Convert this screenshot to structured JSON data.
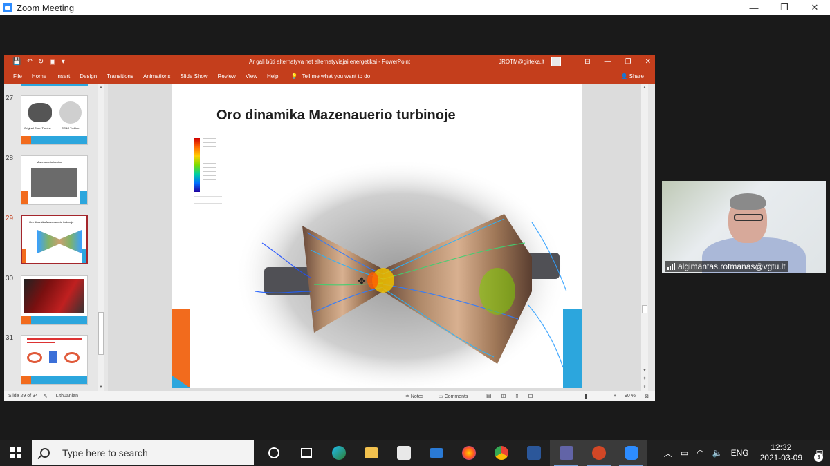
{
  "zoom": {
    "title": "Zoom Meeting",
    "minimize": "—",
    "maximize": "❐",
    "close": "✕"
  },
  "ppt": {
    "doc_title": "Ar gali būti alternatyva net alternatyviajai energetikai  -  PowerPoint",
    "user": "JROTM@girteka.lt",
    "tabs": [
      "File",
      "Home",
      "Insert",
      "Design",
      "Transitions",
      "Animations",
      "Slide Show",
      "Review",
      "View",
      "Help"
    ],
    "tell_me": "Tell me what you want to do",
    "share": "Share",
    "thumbnails": [
      {
        "num": "27",
        "caption_left": "Original Chen Turbine",
        "caption_right": "CEBC Turbine"
      },
      {
        "num": "28",
        "caption": "Mazenauerio turbina"
      },
      {
        "num": "29",
        "caption": "Oro dinamika Mazenauerio turbinoje"
      },
      {
        "num": "30"
      },
      {
        "num": "31"
      }
    ],
    "slide": {
      "title": "Oro dinamika Mazenauerio turbinoje"
    },
    "status": {
      "slide_count": "Slide 29 of 34",
      "language": "Lithuanian",
      "notes": "Notes",
      "comments": "Comments",
      "zoom": "90 %"
    }
  },
  "participant": {
    "name": "algimantas.rotmanas@vgtu.lt"
  },
  "taskbar": {
    "search_placeholder": "Type here to search",
    "lang": "ENG",
    "time": "12:32",
    "date": "2021-03-09",
    "notification_count": "3"
  },
  "colors": {
    "ppt_accent": "#c43e1c",
    "slide_orange": "#f26b1d",
    "slide_blue": "#2ca6dd",
    "zoom_blue": "#2d8cff"
  }
}
